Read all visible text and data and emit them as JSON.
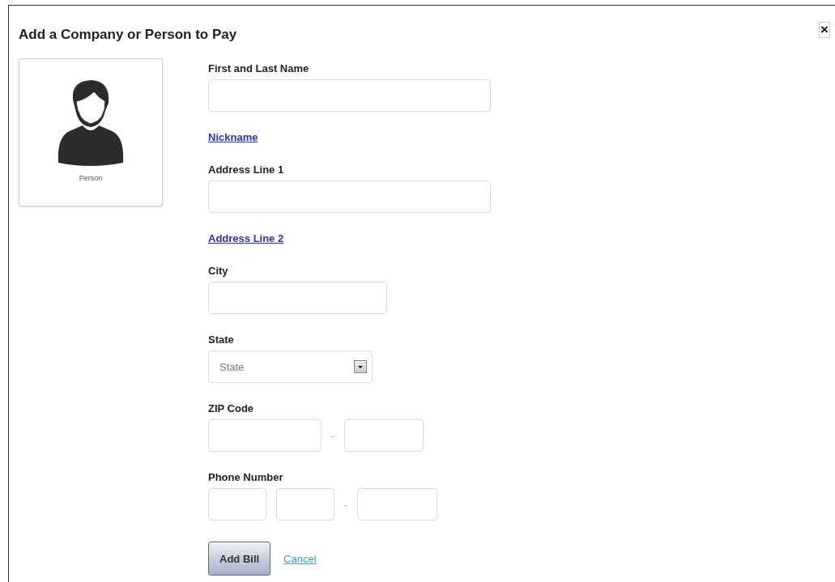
{
  "dialog": {
    "title": "Add a Company or Person to Pay",
    "close": "×"
  },
  "avatar": {
    "caption": "Person"
  },
  "form": [
    {
      "kind": "text",
      "label": "First and Last Name"
    },
    {
      "kind": "link",
      "label": "Nickname"
    },
    {
      "kind": "text",
      "label": "Address Line 1"
    },
    {
      "kind": "link",
      "label": "Address Line 2"
    },
    {
      "kind": "short-text",
      "label": "City"
    },
    {
      "kind": "select",
      "label": "State",
      "placeholder": "State"
    },
    {
      "kind": "zip",
      "label": "ZIP Code",
      "separator": "-"
    },
    {
      "kind": "phone",
      "label": "Phone Number",
      "separator": "-"
    }
  ],
  "buttons": {
    "primary": "Add Bill",
    "cancel": "Cancel"
  }
}
